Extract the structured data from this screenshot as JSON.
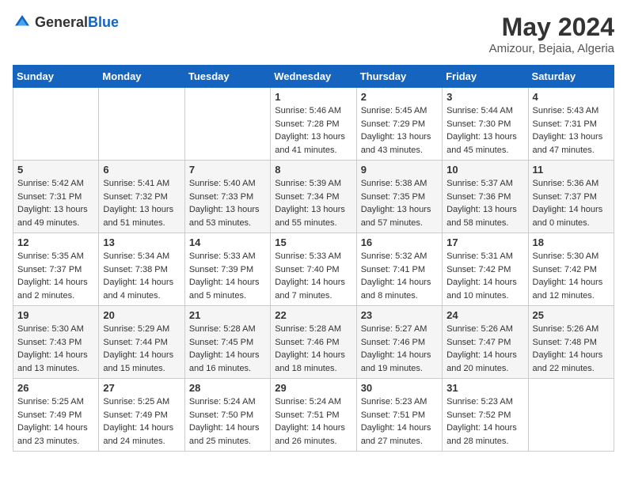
{
  "header": {
    "logo_general": "General",
    "logo_blue": "Blue",
    "month_year": "May 2024",
    "location": "Amizour, Bejaia, Algeria"
  },
  "weekdays": [
    "Sunday",
    "Monday",
    "Tuesday",
    "Wednesday",
    "Thursday",
    "Friday",
    "Saturday"
  ],
  "weeks": [
    [
      {
        "day": "",
        "info": ""
      },
      {
        "day": "",
        "info": ""
      },
      {
        "day": "",
        "info": ""
      },
      {
        "day": "1",
        "info": "Sunrise: 5:46 AM\nSunset: 7:28 PM\nDaylight: 13 hours\nand 41 minutes."
      },
      {
        "day": "2",
        "info": "Sunrise: 5:45 AM\nSunset: 7:29 PM\nDaylight: 13 hours\nand 43 minutes."
      },
      {
        "day": "3",
        "info": "Sunrise: 5:44 AM\nSunset: 7:30 PM\nDaylight: 13 hours\nand 45 minutes."
      },
      {
        "day": "4",
        "info": "Sunrise: 5:43 AM\nSunset: 7:31 PM\nDaylight: 13 hours\nand 47 minutes."
      }
    ],
    [
      {
        "day": "5",
        "info": "Sunrise: 5:42 AM\nSunset: 7:31 PM\nDaylight: 13 hours\nand 49 minutes."
      },
      {
        "day": "6",
        "info": "Sunrise: 5:41 AM\nSunset: 7:32 PM\nDaylight: 13 hours\nand 51 minutes."
      },
      {
        "day": "7",
        "info": "Sunrise: 5:40 AM\nSunset: 7:33 PM\nDaylight: 13 hours\nand 53 minutes."
      },
      {
        "day": "8",
        "info": "Sunrise: 5:39 AM\nSunset: 7:34 PM\nDaylight: 13 hours\nand 55 minutes."
      },
      {
        "day": "9",
        "info": "Sunrise: 5:38 AM\nSunset: 7:35 PM\nDaylight: 13 hours\nand 57 minutes."
      },
      {
        "day": "10",
        "info": "Sunrise: 5:37 AM\nSunset: 7:36 PM\nDaylight: 13 hours\nand 58 minutes."
      },
      {
        "day": "11",
        "info": "Sunrise: 5:36 AM\nSunset: 7:37 PM\nDaylight: 14 hours\nand 0 minutes."
      }
    ],
    [
      {
        "day": "12",
        "info": "Sunrise: 5:35 AM\nSunset: 7:37 PM\nDaylight: 14 hours\nand 2 minutes."
      },
      {
        "day": "13",
        "info": "Sunrise: 5:34 AM\nSunset: 7:38 PM\nDaylight: 14 hours\nand 4 minutes."
      },
      {
        "day": "14",
        "info": "Sunrise: 5:33 AM\nSunset: 7:39 PM\nDaylight: 14 hours\nand 5 minutes."
      },
      {
        "day": "15",
        "info": "Sunrise: 5:33 AM\nSunset: 7:40 PM\nDaylight: 14 hours\nand 7 minutes."
      },
      {
        "day": "16",
        "info": "Sunrise: 5:32 AM\nSunset: 7:41 PM\nDaylight: 14 hours\nand 8 minutes."
      },
      {
        "day": "17",
        "info": "Sunrise: 5:31 AM\nSunset: 7:42 PM\nDaylight: 14 hours\nand 10 minutes."
      },
      {
        "day": "18",
        "info": "Sunrise: 5:30 AM\nSunset: 7:42 PM\nDaylight: 14 hours\nand 12 minutes."
      }
    ],
    [
      {
        "day": "19",
        "info": "Sunrise: 5:30 AM\nSunset: 7:43 PM\nDaylight: 14 hours\nand 13 minutes."
      },
      {
        "day": "20",
        "info": "Sunrise: 5:29 AM\nSunset: 7:44 PM\nDaylight: 14 hours\nand 15 minutes."
      },
      {
        "day": "21",
        "info": "Sunrise: 5:28 AM\nSunset: 7:45 PM\nDaylight: 14 hours\nand 16 minutes."
      },
      {
        "day": "22",
        "info": "Sunrise: 5:28 AM\nSunset: 7:46 PM\nDaylight: 14 hours\nand 18 minutes."
      },
      {
        "day": "23",
        "info": "Sunrise: 5:27 AM\nSunset: 7:46 PM\nDaylight: 14 hours\nand 19 minutes."
      },
      {
        "day": "24",
        "info": "Sunrise: 5:26 AM\nSunset: 7:47 PM\nDaylight: 14 hours\nand 20 minutes."
      },
      {
        "day": "25",
        "info": "Sunrise: 5:26 AM\nSunset: 7:48 PM\nDaylight: 14 hours\nand 22 minutes."
      }
    ],
    [
      {
        "day": "26",
        "info": "Sunrise: 5:25 AM\nSunset: 7:49 PM\nDaylight: 14 hours\nand 23 minutes."
      },
      {
        "day": "27",
        "info": "Sunrise: 5:25 AM\nSunset: 7:49 PM\nDaylight: 14 hours\nand 24 minutes."
      },
      {
        "day": "28",
        "info": "Sunrise: 5:24 AM\nSunset: 7:50 PM\nDaylight: 14 hours\nand 25 minutes."
      },
      {
        "day": "29",
        "info": "Sunrise: 5:24 AM\nSunset: 7:51 PM\nDaylight: 14 hours\nand 26 minutes."
      },
      {
        "day": "30",
        "info": "Sunrise: 5:23 AM\nSunset: 7:51 PM\nDaylight: 14 hours\nand 27 minutes."
      },
      {
        "day": "31",
        "info": "Sunrise: 5:23 AM\nSunset: 7:52 PM\nDaylight: 14 hours\nand 28 minutes."
      },
      {
        "day": "",
        "info": ""
      }
    ]
  ]
}
